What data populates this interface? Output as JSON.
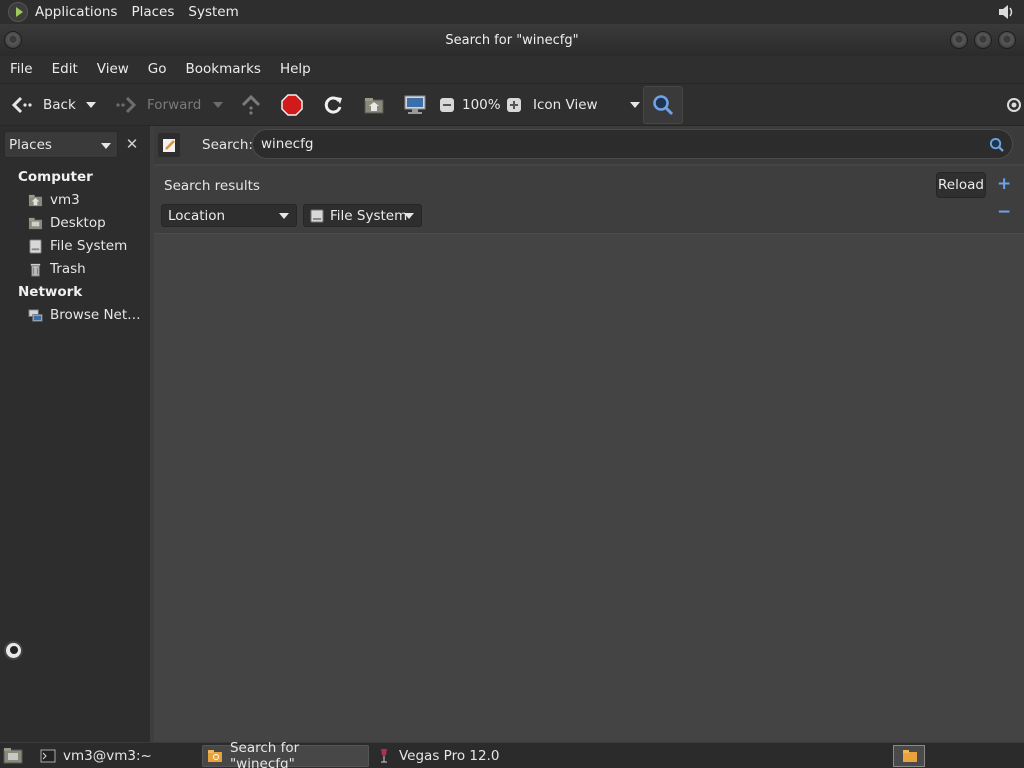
{
  "top_panel": {
    "menus": [
      "Applications",
      "Places",
      "System"
    ]
  },
  "window": {
    "title": "Search for \"winecfg\""
  },
  "menubar": [
    "File",
    "Edit",
    "View",
    "Go",
    "Bookmarks",
    "Help"
  ],
  "toolbar": {
    "back": "Back",
    "forward": "Forward",
    "zoom": "100%",
    "view_mode": "Icon View"
  },
  "sidebar": {
    "selector": "Places",
    "sections": [
      {
        "title": "Computer",
        "items": [
          "vm3",
          "Desktop",
          "File System",
          "Trash"
        ]
      },
      {
        "title": "Network",
        "items": [
          "Browse Net…"
        ]
      }
    ]
  },
  "search": {
    "label": "Search:",
    "query": "winecfg"
  },
  "results": {
    "label": "Search results",
    "reload": "Reload",
    "add": "+",
    "remove": "−",
    "criteria_type": "Location",
    "criteria_value": "File System"
  },
  "taskbar": {
    "tasks": [
      "vm3@vm3:~",
      "Search for \"winecfg\"",
      "Vegas Pro 12.0"
    ]
  },
  "colors": {
    "accent": "#6fa3e8",
    "stop_red": "#d11a1a",
    "folder_orange": "#e8a33c"
  }
}
